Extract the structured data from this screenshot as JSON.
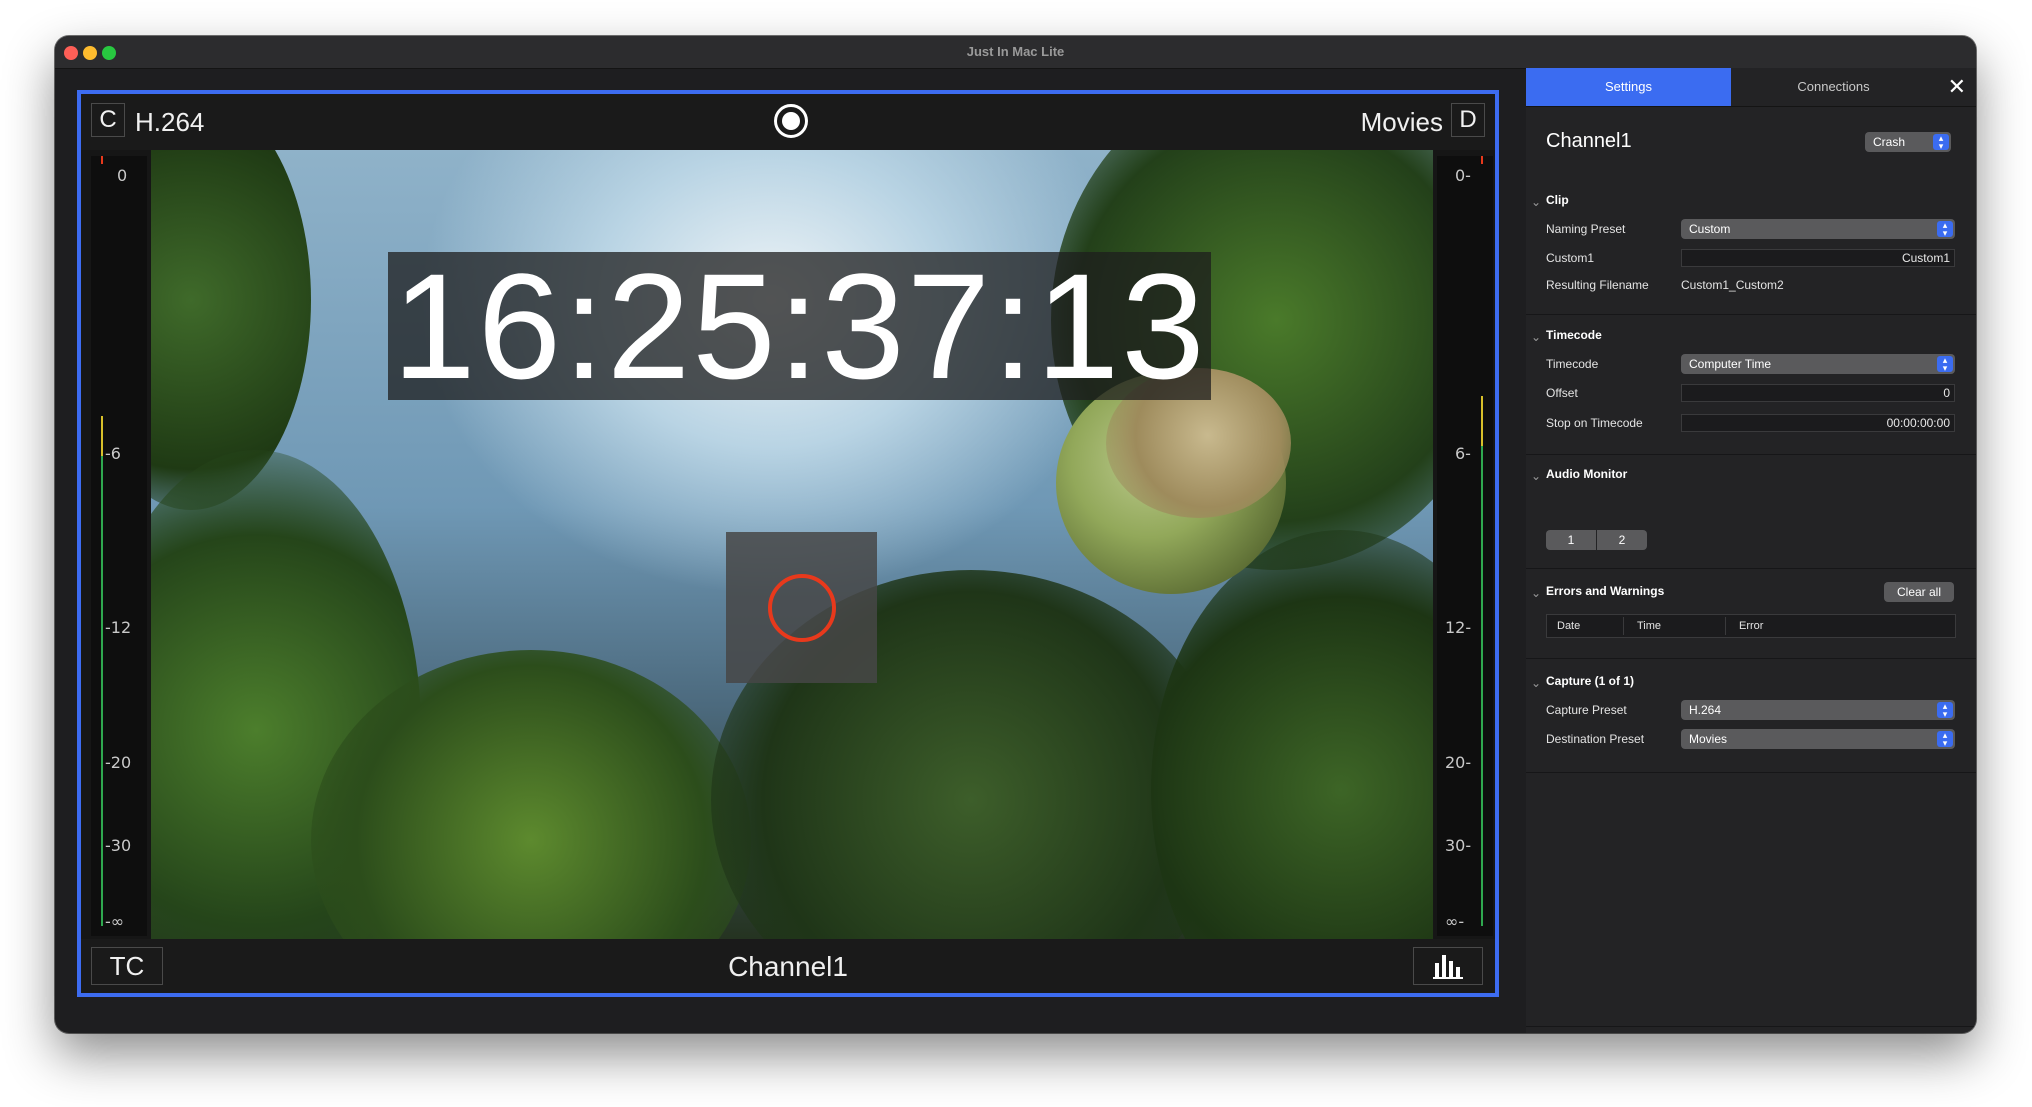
{
  "window": {
    "title": "Just In Mac Lite"
  },
  "preview": {
    "corner_left": "C",
    "codec": "H.264",
    "destination": "Movies",
    "corner_right": "D",
    "timecode": "16:25:37:13",
    "tc_button": "TC",
    "channel_title": "Channel1",
    "meter_ticks": [
      "0",
      "-6",
      "-12",
      "-20",
      "-30",
      "-∞"
    ],
    "meter_ticks_right": [
      "0-",
      "6-",
      "12-",
      "20-",
      "30-",
      "∞-"
    ],
    "icons": [
      "record-icon",
      "record-overlay-icon",
      "audio-meter-icon"
    ]
  },
  "panel": {
    "tabs": [
      "Settings",
      "Connections"
    ],
    "active_tab": "Settings",
    "channel_name": "Channel1",
    "channel_menu": "Crash",
    "clip": {
      "title": "Clip",
      "naming_preset_label": "Naming Preset",
      "naming_preset_value": "Custom",
      "custom1_label": "Custom1",
      "custom1_value": "Custom1",
      "resulting_label": "Resulting Filename",
      "resulting_value": "Custom1_Custom2"
    },
    "timecode": {
      "title": "Timecode",
      "timecode_label": "Timecode",
      "timecode_value": "Computer Time",
      "offset_label": "Offset",
      "offset_value": "0",
      "stop_label": "Stop on Timecode",
      "stop_value": "00:00:00:00"
    },
    "audio_monitor": {
      "title": "Audio Monitor",
      "channels": [
        "1",
        "2"
      ]
    },
    "errors": {
      "title": "Errors and Warnings",
      "clear_label": "Clear all",
      "columns": [
        "Date",
        "Time",
        "Error"
      ]
    },
    "capture": {
      "title": "Capture (1 of 1)",
      "capture_preset_label": "Capture Preset",
      "capture_preset_value": "H.264",
      "destination_preset_label": "Destination Preset",
      "destination_preset_value": "Movies"
    }
  },
  "colors": {
    "accent": "#3b6cf1",
    "record_red": "#e8391c",
    "meter_green": "#2fa84f",
    "meter_yellow": "#d8c02a"
  }
}
